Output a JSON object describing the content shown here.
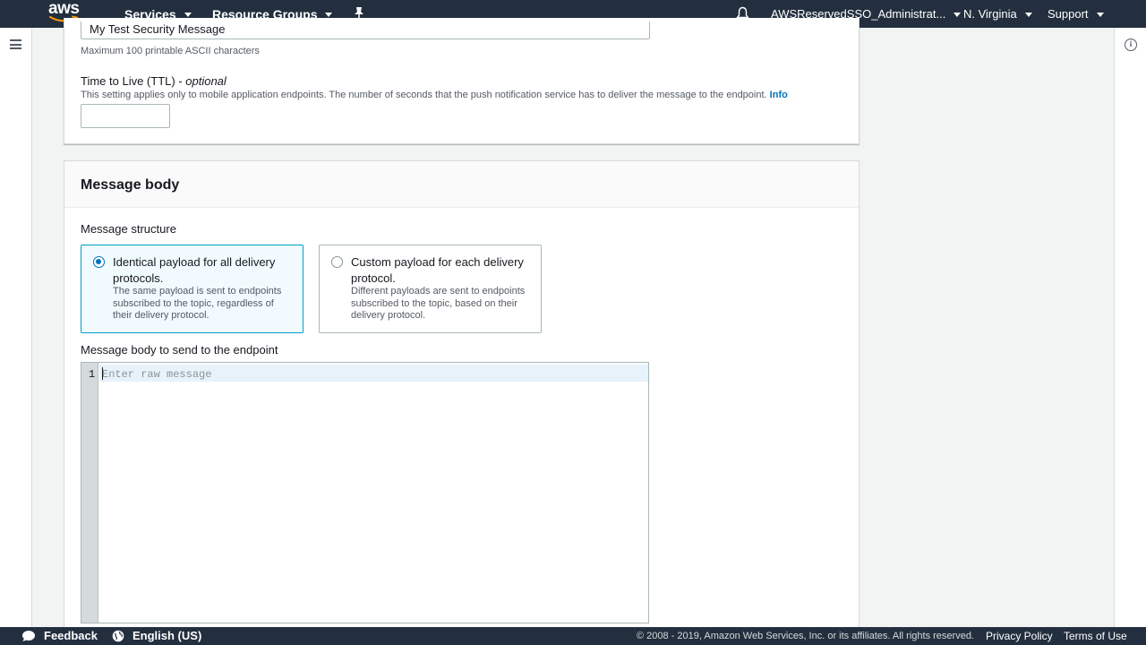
{
  "topnav": {
    "logo_text": "aws",
    "services_label": "Services",
    "resource_groups_label": "Resource Groups",
    "account_label": "AWSReservedSSO_Administrat...",
    "region_label": "N. Virginia",
    "support_label": "Support"
  },
  "form": {
    "subject_value": "My Test Security Message",
    "subject_hint": "Maximum 100 printable ASCII characters",
    "ttl_label": "Time to Live (TTL)",
    "ttl_optional": "optional",
    "ttl_separator": " - ",
    "ttl_hint": "This setting applies only to mobile application endpoints. The number of seconds that the push notification service has to deliver the message to the endpoint.",
    "ttl_info_link": "Info",
    "ttl_value": ""
  },
  "message_body": {
    "title": "Message body",
    "structure_label": "Message structure",
    "options": [
      {
        "title": "Identical payload for all delivery protocols.",
        "description": "The same payload is sent to endpoints subscribed to the topic, regardless of their delivery protocol.",
        "selected": true
      },
      {
        "title": "Custom payload for each delivery protocol.",
        "description": "Different payloads are sent to endpoints subscribed to the topic, based on their delivery protocol.",
        "selected": false
      }
    ],
    "editor_label": "Message body to send to the endpoint",
    "editor_line_number": "1",
    "editor_placeholder": "Enter raw message"
  },
  "footer": {
    "feedback_label": "Feedback",
    "language_label": "English (US)",
    "copyright": "© 2008 - 2019, Amazon Web Services, Inc. or its affiliates. All rights reserved.",
    "privacy_label": "Privacy Policy",
    "terms_label": "Terms of Use"
  },
  "colors": {
    "nav_bg": "#232f3e",
    "accent": "#0073bb",
    "selected_tile_border": "#00a1c9",
    "aws_smile": "#ff9900"
  }
}
